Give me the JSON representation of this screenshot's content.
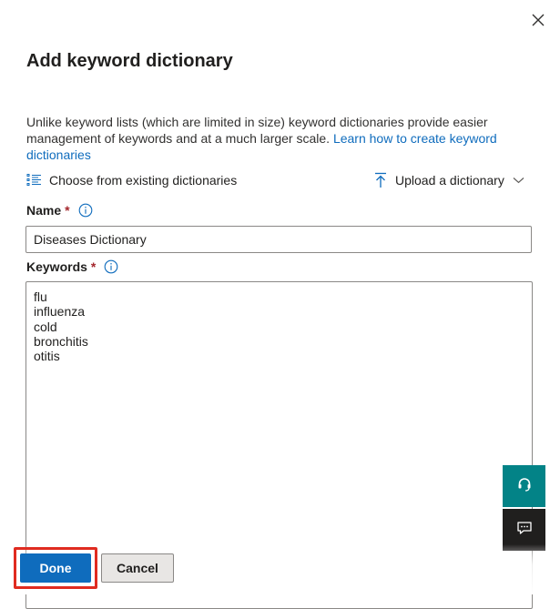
{
  "panel": {
    "title": "Add keyword dictionary",
    "close_icon": "close-icon",
    "description": "Unlike keyword lists (which are limited in size) keyword dictionaries provide easier management of keywords and at a much larger scale.",
    "learn_link": "Learn how to create keyword dictionaries"
  },
  "toolbar": {
    "choose_label": "Choose from existing dictionaries",
    "choose_icon": "list-icon",
    "upload_label": "Upload a dictionary",
    "upload_icon": "upload-icon",
    "upload_chevron": "chevron-down-icon"
  },
  "fields": {
    "name": {
      "label": "Name",
      "required_mark": "*",
      "value": "Diseases Dictionary"
    },
    "keywords": {
      "label": "Keywords",
      "required_mark": "*",
      "lines": [
        "flu",
        "influenza",
        "cold",
        "bronchitis",
        "otitis"
      ]
    }
  },
  "side_buttons": {
    "help_icon": "headset-icon",
    "feedback_icon": "feedback-icon"
  },
  "footer": {
    "done_label": "Done",
    "cancel_label": "Cancel"
  },
  "colors": {
    "accent": "#0f6cbd",
    "required": "#a4262c",
    "help_teal": "#038387",
    "highlight": "#e02b20"
  }
}
